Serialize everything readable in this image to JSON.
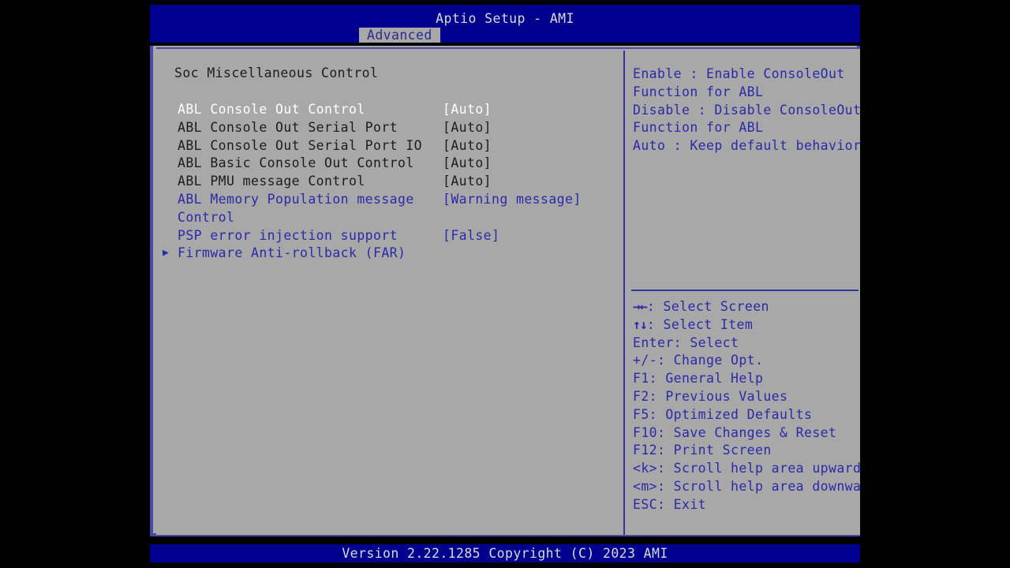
{
  "window": {
    "title": "Aptio Setup - AMI",
    "accent_blue": "#00008f",
    "panel_gray": "#a8a8a8",
    "text_blue": "#2a2aa8",
    "text_dim": "#1c1c1c",
    "text_selected": "#ffffff"
  },
  "tabs": [
    {
      "label": "Advanced",
      "active": true
    }
  ],
  "settings_pane": {
    "heading": "Soc Miscellaneous Control",
    "rows": [
      {
        "marker": "",
        "label": "ABL Console Out Control",
        "value": "[Auto]",
        "state": "selected"
      },
      {
        "marker": "",
        "label": "ABL Console Out Serial Port",
        "value": "[Auto]",
        "state": "dim"
      },
      {
        "marker": "",
        "label": "ABL Console Out Serial Port IO",
        "value": "[Auto]",
        "state": "dim"
      },
      {
        "marker": "",
        "label": "ABL Basic Console Out Control",
        "value": "[Auto]",
        "state": "dim"
      },
      {
        "marker": "",
        "label": "ABL PMU message Control",
        "value": "[Auto]",
        "state": "dim"
      },
      {
        "marker": "",
        "label": "ABL Memory Population message",
        "value": "[Warning message]",
        "state": "blue"
      },
      {
        "marker": "",
        "label": "Control",
        "value": "",
        "state": "blue",
        "continuation": true
      },
      {
        "marker": "",
        "label": "PSP error injection support",
        "value": "[False]",
        "state": "blue"
      },
      {
        "marker": "▶",
        "label": "Firmware Anti-rollback (FAR)",
        "value": "",
        "state": "blue",
        "submenu": true
      }
    ]
  },
  "help_pane": {
    "description_lines": [
      "Enable : Enable ConsoleOut",
      "Function for ABL",
      "Disable : Disable ConsoleOut",
      "Function for ABL",
      "Auto : Keep default behavior"
    ],
    "key_legend": [
      {
        "glyph": "→←",
        "text": ": Select Screen"
      },
      {
        "glyph": "↑↓",
        "text": ": Select Item"
      },
      {
        "glyph": "",
        "text": "Enter: Select"
      },
      {
        "glyph": "",
        "text": "+/-: Change Opt."
      },
      {
        "glyph": "",
        "text": "F1: General Help"
      },
      {
        "glyph": "",
        "text": "F2: Previous Values"
      },
      {
        "glyph": "",
        "text": "F5: Optimized Defaults"
      },
      {
        "glyph": "",
        "text": "F10: Save Changes & Reset"
      },
      {
        "glyph": "",
        "text": "F12: Print Screen"
      },
      {
        "glyph": "",
        "text": "<k>: Scroll help area upwards"
      },
      {
        "glyph": "",
        "text": "<m>: Scroll help area downwards"
      },
      {
        "glyph": "",
        "text": "ESC: Exit"
      }
    ]
  },
  "footer": {
    "version_text": "Version 2.22.1285 Copyright (C) 2023 AMI"
  }
}
